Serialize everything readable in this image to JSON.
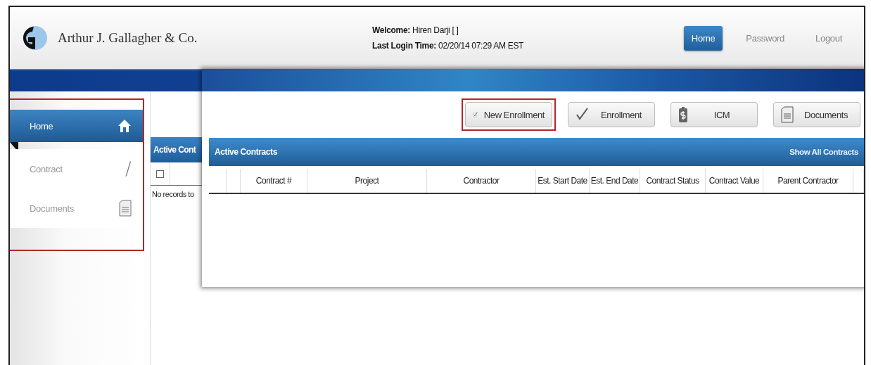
{
  "header": {
    "company": "Arthur J. Gallagher & Co.",
    "welcome": "**Welcome:** Hiren Darji [ ]",
    "last_login": "**Last Login Time:** 02/20/14 07:29 AM EST",
    "nav": [
      {
        "label": "Home",
        "selected": true
      },
      {
        "label": "Password",
        "selected": false
      },
      {
        "label": "Logout",
        "selected": false
      }
    ]
  },
  "sidebar": {
    "highlighted": true,
    "items": [
      {
        "label": "Home",
        "kind": "home",
        "selected": true
      },
      {
        "label": "Contract",
        "kind": "pencil",
        "selected": false
      },
      {
        "label": "Documents",
        "kind": "document",
        "selected": false
      }
    ]
  },
  "background_panel": {
    "title": "Active Cont",
    "checked": false,
    "empty_text": "No records to"
  },
  "popup": {
    "buttons": [
      {
        "label": "New Enrollment",
        "kind": "checklist",
        "highlighted": true
      },
      {
        "label": "Enrollment",
        "kind": "check",
        "highlighted": false
      },
      {
        "label": "ICM",
        "kind": "money",
        "highlighted": false
      },
      {
        "label": "Documents",
        "kind": "document",
        "highlighted": false
      }
    ],
    "table": {
      "title": "Active Contracts",
      "link": "Show All Contracts",
      "columns": [
        "Contract #",
        "Project",
        "Contractor",
        "Est. Start Date",
        "Est. End Date",
        "Contract Status",
        "Contract Value",
        "Parent Contractor"
      ]
    }
  }
}
